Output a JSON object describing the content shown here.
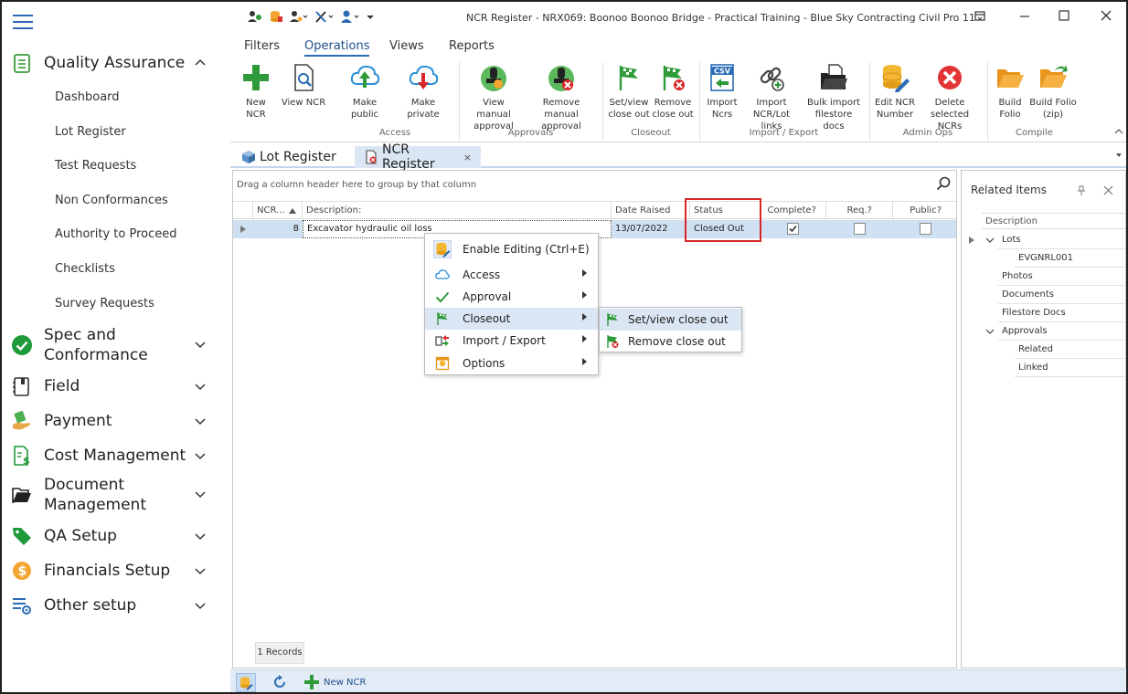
{
  "window": {
    "title": "NCR Register - NRX069: Boonoo Boonoo Bridge - Practical Training - Blue Sky Contracting Civil Pro 11"
  },
  "nav": {
    "head": "Quality Assurance",
    "sub_items": [
      "Dashboard",
      "Lot Register",
      "Test Requests",
      "Non Conformances",
      "Authority to Proceed",
      "Checklists",
      "Survey Requests"
    ],
    "sections": [
      {
        "label": "Spec and",
        "label2": "Conformance"
      },
      {
        "label": "Field"
      },
      {
        "label": "Payment"
      },
      {
        "label": "Cost Management"
      },
      {
        "label": "Document",
        "label2": "Management"
      },
      {
        "label": "QA Setup"
      },
      {
        "label": "Financials Setup"
      },
      {
        "label": "Other setup"
      }
    ]
  },
  "ribbon": {
    "tabs": [
      "Filters",
      "Operations",
      "Views",
      "Reports"
    ],
    "active_tab": "Operations",
    "buttons": {
      "new_ncr": "New NCR",
      "view_ncr": "View NCR",
      "make_public": "Make public",
      "make_private": "Make private",
      "view_manual": "View manual",
      "view_manual2": "approval",
      "remove_manual": "Remove manual",
      "remove_manual2": "approval",
      "setview": "Set/view",
      "setview2": "close out",
      "remove": "Remove",
      "remove2": "close out",
      "import": "Import",
      "import2": "Ncrs",
      "import_links": "Import",
      "import_links2": "NCR/Lot links",
      "bulk": "Bulk import",
      "bulk2": "filestore docs",
      "edit_ncr": "Edit NCR",
      "edit_ncr2": "Number",
      "delete": "Delete",
      "delete2": "selected NCRs",
      "build": "Build",
      "build2": "Folio",
      "build_zip": "Build Folio",
      "build_zip2": "(zip)"
    },
    "groups": {
      "access": "Access",
      "approvals": "Approvals",
      "closeout": "Closeout",
      "import_export": "Import / Export",
      "admin_ops": "Admin Ops",
      "compile": "Compile"
    }
  },
  "doc_tabs": {
    "lot_register": "Lot Register",
    "ncr_register": "NCR Register",
    "close": "×"
  },
  "grid": {
    "group_hint": "Drag a column header here to group by that column",
    "headers": {
      "ncr": "NCR...",
      "description": "Description:",
      "date_raised": "Date Raised",
      "status": "Status",
      "complete": "Complete?",
      "req": "Req.?",
      "public": "Public?"
    },
    "row": {
      "ncr": "8",
      "description": "Excavator hydraulic oil loss",
      "date_raised": "13/07/2022",
      "status": "Closed Out",
      "complete": true,
      "req": false,
      "public": false
    },
    "records": "1 Records"
  },
  "context_menu": {
    "items": [
      "Enable Editing (Ctrl+E)",
      "Access",
      "Approval",
      "Closeout",
      "Import / Export",
      "Options"
    ],
    "submenu": [
      "Set/view close out",
      "Remove close out"
    ]
  },
  "related": {
    "title": "Related Items",
    "header": "Description",
    "nodes": {
      "lots": "Lots",
      "lot1": "EVGNRL001",
      "photos": "Photos",
      "documents": "Documents",
      "filestore": "Filestore Docs",
      "approvals": "Approvals",
      "related": "Related",
      "linked": "Linked"
    }
  },
  "statusbar": {
    "new_ncr": "New NCR"
  },
  "colors": {
    "accent": "#2b6cb5",
    "highlight_box": "#d92626",
    "selection": "#cfe0f3"
  }
}
